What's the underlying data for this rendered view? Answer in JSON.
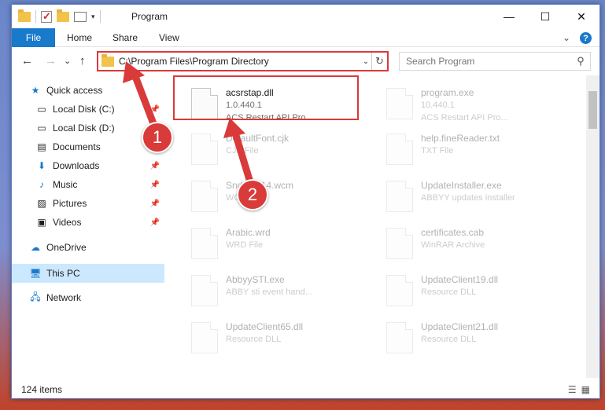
{
  "titlebar": {
    "title": "Program",
    "minimize": "—",
    "maximize": "☐",
    "close": "✕"
  },
  "ribbon": {
    "file": "File",
    "tabs": [
      "Home",
      "Share",
      "View"
    ]
  },
  "nav": {
    "back": "←",
    "forward": "→",
    "history": "⌄",
    "up": "↑"
  },
  "address": {
    "path": "C:\\Program Files\\Program Directory",
    "dropdown": "⌄",
    "refresh": "↻"
  },
  "search": {
    "placeholder": "Search Program"
  },
  "sidebar": {
    "items": [
      {
        "label": "Quick access",
        "icon": "star-icon"
      },
      {
        "label": "Local Disk (C:)",
        "icon": "drive-icon"
      },
      {
        "label": "Local Disk (D:)",
        "icon": "drive-icon"
      },
      {
        "label": "Documents",
        "icon": "documents-icon"
      },
      {
        "label": "Downloads",
        "icon": "download-icon"
      },
      {
        "label": "Music",
        "icon": "music-icon"
      },
      {
        "label": "Pictures",
        "icon": "pictures-icon"
      },
      {
        "label": "Videos",
        "icon": "videos-icon"
      },
      {
        "label": "OneDrive",
        "icon": "cloud-icon"
      },
      {
        "label": "This PC",
        "icon": "computer-icon"
      },
      {
        "label": "Network",
        "icon": "network-icon"
      }
    ]
  },
  "files": [
    {
      "name": "acsrstap.dll",
      "version": "1.0.440.1",
      "desc": "ACS Restart API Pro...",
      "icon": "dll-icon"
    },
    {
      "name": "program.exe",
      "version": "10.440.1",
      "desc": "ACS Restart API Pro...",
      "icon": "exe-icon"
    },
    {
      "name": "DefaultFont.cjk",
      "version": "CJK File",
      "desc": "",
      "icon": "file-icon"
    },
    {
      "name": "help.fineReader.txt",
      "version": "TXT File",
      "desc": "",
      "icon": "file-icon"
    },
    {
      "name": "Snd_ocr14.wcm",
      "version": "WCM File",
      "desc": "",
      "icon": "file-icon"
    },
    {
      "name": "UpdateInstaller.exe",
      "version": "ABBYY updates installer",
      "desc": "",
      "icon": "installer-icon"
    },
    {
      "name": "Arabic.wrd",
      "version": "WRD File",
      "desc": "",
      "icon": "file-icon"
    },
    {
      "name": "certificates.cab",
      "version": "WinRAR Archive",
      "desc": "",
      "icon": "archive-icon"
    },
    {
      "name": "AbbyySTI.exe",
      "version": "ABBY sti event hand...",
      "desc": "",
      "icon": "exe-icon"
    },
    {
      "name": "UpdateClient19.dll",
      "version": "Resource DLL",
      "desc": "",
      "icon": "dll-icon"
    },
    {
      "name": "UpdateClient65.dll",
      "version": "Resource DLL",
      "desc": "",
      "icon": "dll-icon"
    },
    {
      "name": "UpdateClient21.dll",
      "version": "Resource DLL",
      "desc": "",
      "icon": "dll-icon"
    }
  ],
  "status": {
    "count": "124 items"
  },
  "annotations": {
    "step1": "1",
    "step2": "2"
  },
  "colors": {
    "accent": "#1979ca",
    "highlight": "#d93a3a"
  }
}
